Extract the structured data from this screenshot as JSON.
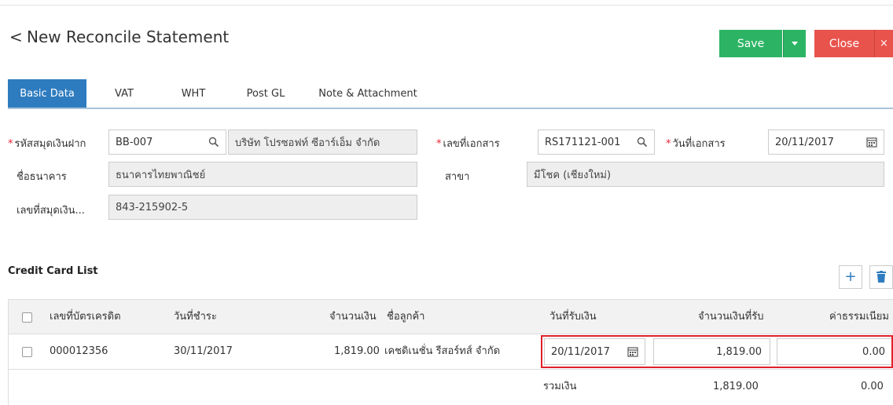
{
  "header": {
    "back_glyph": "<",
    "title": "New Reconcile Statement",
    "save_label": "Save",
    "close_label": "Close",
    "close_x": "×"
  },
  "tabs": [
    {
      "label": "Basic Data",
      "active": true
    },
    {
      "label": "VAT",
      "active": false
    },
    {
      "label": "WHT",
      "active": false
    },
    {
      "label": "Post GL",
      "active": false
    },
    {
      "label": "Note & Attachment",
      "active": false
    }
  ],
  "form": {
    "required_mark": "*",
    "bankbook_code_label": "รหัสสมุดเงินฝาก",
    "bankbook_code_value": "BB-007",
    "company_name_value": "บริษัท โปรซอฟท์ ซีอาร์เอ็ม จำกัด",
    "document_no_label": "เลขที่เอกสาร",
    "document_no_value": "RS171121-001",
    "document_date_label": "วันที่เอกสาร",
    "document_date_value": "20/11/2017",
    "bank_name_label": "ชื่อธนาคาร",
    "bank_name_value": "ธนาคารไทยพาณิชย์",
    "branch_label": "สาขา",
    "branch_value": "มีโชค (เชียงใหม่)",
    "account_no_label": "เลขที่สมุดเงิน...",
    "account_no_value": "843-215902-5"
  },
  "credit_card_list": {
    "title": "Credit Card List",
    "add_icon": "+",
    "columns": {
      "card_no": "เลขที่บัตรเครดิต",
      "due_date": "วันที่ชำระ",
      "amount": "จำนวนเงิน",
      "customer": "ชื่อลูกค้า",
      "received_date": "วันที่รับเงิน",
      "received_amount": "จำนวนเงินที่รับ",
      "fee": "ค่าธรรมเนียม"
    },
    "rows": [
      {
        "card_no": "000012356",
        "due_date": "30/11/2017",
        "amount": "1,819.00",
        "customer": "เคชดิเนชั่น รีสอร์ทส์ จำกัด",
        "received_date": "20/11/2017",
        "received_amount": "1,819.00",
        "fee": "0.00"
      }
    ],
    "footer": {
      "total_label": "รวมเงิน",
      "total_received": "1,819.00",
      "total_fee": "0.00"
    }
  },
  "colors": {
    "save": "#2cb464",
    "close": "#e8534c",
    "active_tab": "#2e7cbf",
    "highlight": "#e0202a"
  }
}
